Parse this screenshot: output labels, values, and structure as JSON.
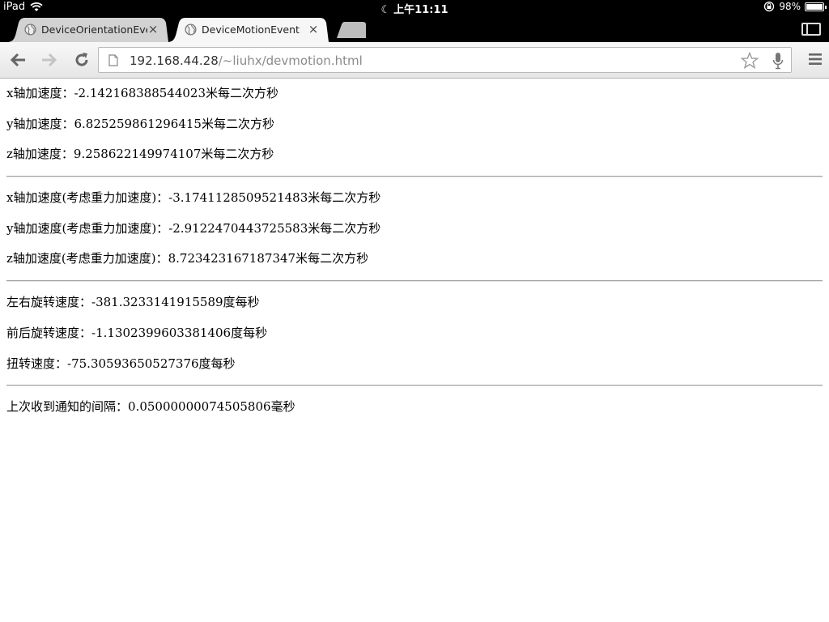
{
  "statusbar": {
    "device": "iPad",
    "time": "上午11:11",
    "battery": "98%",
    "battery_level": 0.98
  },
  "tabs": [
    {
      "title": "DeviceOrientationEvent",
      "active": false
    },
    {
      "title": "DeviceMotionEvent",
      "active": true
    }
  ],
  "omnibox": {
    "host": "192.168.44.28",
    "path": "/~liuhx/devmotion.html"
  },
  "acceleration": [
    {
      "label": "x轴加速度：",
      "value": "-2.142168388544023米每二次方秒"
    },
    {
      "label": "y轴加速度：",
      "value": "6.825259861296415米每二次方秒"
    },
    {
      "label": "z轴加速度：",
      "value": "9.258622149974107米每二次方秒"
    }
  ],
  "acceleration_gravity": [
    {
      "label": "x轴加速度(考虑重力加速度)：",
      "value": "-3.1741128509521483米每二次方秒"
    },
    {
      "label": "y轴加速度(考虑重力加速度)：",
      "value": "-2.9122470443725583米每二次方秒"
    },
    {
      "label": "z轴加速度(考虑重力加速度)：",
      "value": "8.723423167187347米每二次方秒"
    }
  ],
  "rotation": [
    {
      "label": "左右旋转速度：",
      "value": "-381.3233141915589度每秒"
    },
    {
      "label": "前后旋转速度：",
      "value": "-1.1302399603381406度每秒"
    },
    {
      "label": "扭转速度：",
      "value": "-75.30593650527376度每秒"
    }
  ],
  "interval": {
    "label": "上次收到通知的间隔：",
    "value": "0.05000000074505806毫秒"
  }
}
